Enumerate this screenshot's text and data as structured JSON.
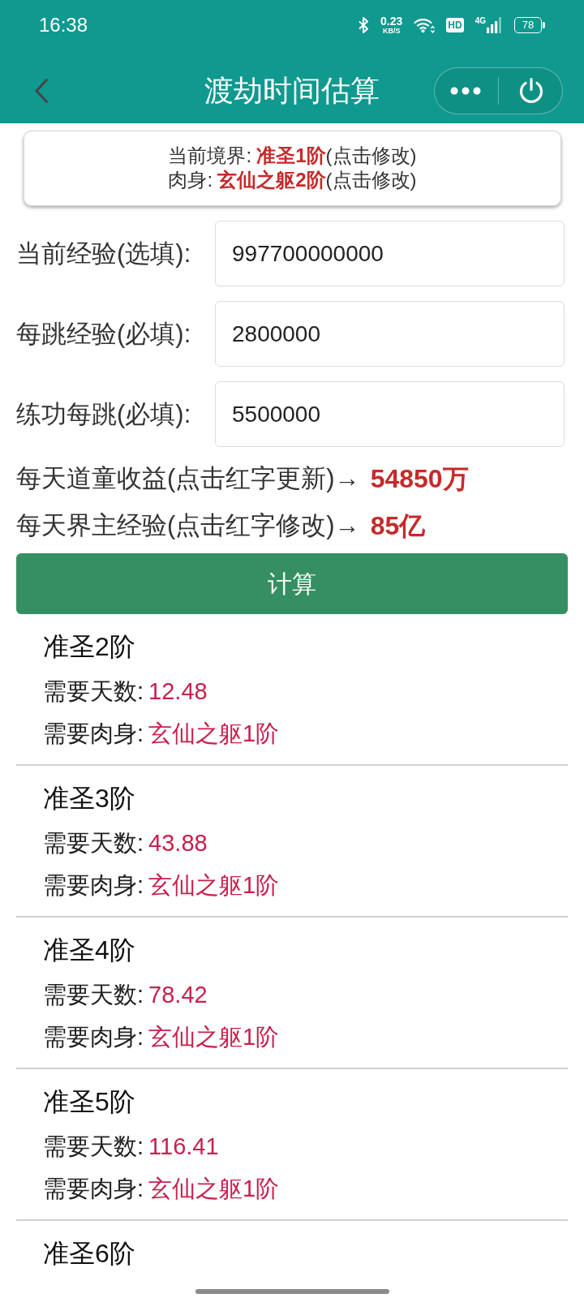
{
  "status_bar": {
    "time": "16:38",
    "network_speed": {
      "value": "0.23",
      "unit": "KB/S"
    },
    "hd_badge": "HD",
    "network_type": "4G",
    "battery": "78"
  },
  "header": {
    "title": "渡劫时间估算"
  },
  "realm_card": {
    "lines": [
      {
        "label": "当前境界:",
        "value": "准圣1阶",
        "hint": "(点击修改)"
      },
      {
        "label": "肉身:",
        "value": "玄仙之躯2阶",
        "hint": "(点击修改)"
      }
    ]
  },
  "fields": [
    {
      "label": "当前经验(选填):",
      "value": "997700000000"
    },
    {
      "label": "每跳经验(必填):",
      "value": "2800000"
    },
    {
      "label": "练功每跳(必填):",
      "value": "5500000"
    }
  ],
  "daily": [
    {
      "label": "每天道童收益(点击红字更新)→",
      "value": "54850万"
    },
    {
      "label": "每天界主经验(点击红字修改)→",
      "value": "85亿"
    }
  ],
  "calculate_button": "计算",
  "results": [
    {
      "title": "准圣2阶",
      "rows": [
        {
          "label": "需要天数:",
          "value": "12.48"
        },
        {
          "label": "需要肉身:",
          "value": "玄仙之躯1阶"
        }
      ]
    },
    {
      "title": "准圣3阶",
      "rows": [
        {
          "label": "需要天数:",
          "value": "43.88"
        },
        {
          "label": "需要肉身:",
          "value": "玄仙之躯1阶"
        }
      ]
    },
    {
      "title": "准圣4阶",
      "rows": [
        {
          "label": "需要天数:",
          "value": "78.42"
        },
        {
          "label": "需要肉身:",
          "value": "玄仙之躯1阶"
        }
      ]
    },
    {
      "title": "准圣5阶",
      "rows": [
        {
          "label": "需要天数:",
          "value": "116.41"
        },
        {
          "label": "需要肉身:",
          "value": "玄仙之躯1阶"
        }
      ]
    },
    {
      "title": "准圣6阶"
    }
  ]
}
